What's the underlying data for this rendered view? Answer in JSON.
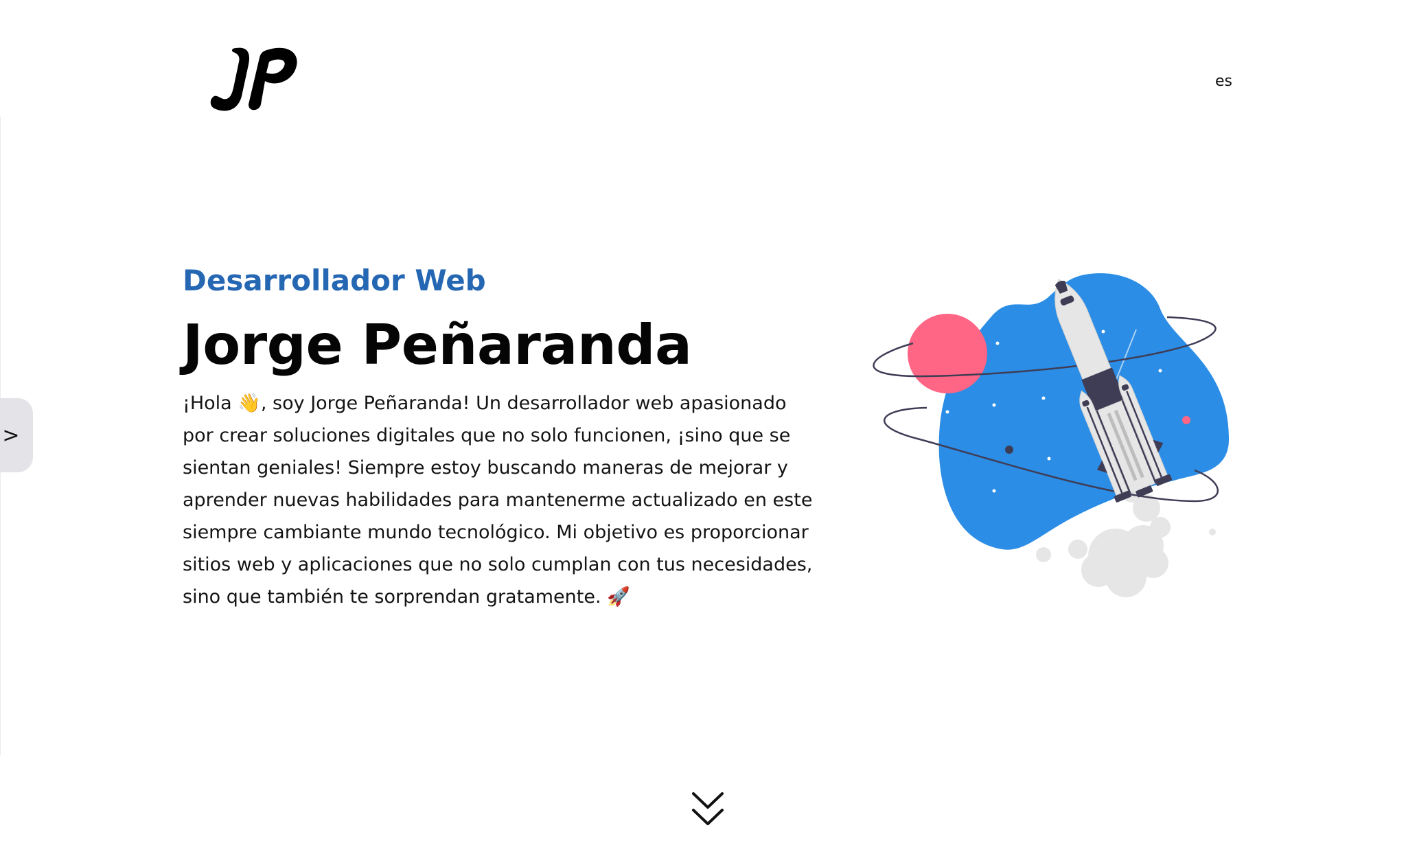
{
  "header": {
    "logo": "JP",
    "language": "es"
  },
  "sidebar": {
    "toggle_label": ">"
  },
  "hero": {
    "role": "Desarrollador Web",
    "name": "Jorge Peñaranda",
    "bio": "¡Hola 👋, soy Jorge Peñaranda! Un desarrollador web apasionado por crear soluciones digitales que no solo funcionen, ¡sino que se sientan geniales! Siempre estoy buscando maneras de mejorar y aprender nuevas habilidades para mantenerme actualizado en este siempre cambiante mundo tecnológico. Mi objetivo es proporcionar sitios web y aplicaciones que no solo cumplan con tus necesidades, sino que también te sorprendan gratamente. 🚀"
  },
  "icons": {
    "scroll": "double-chevron-down-icon",
    "illustration": "rocket-launch-illustration"
  },
  "colors": {
    "accent": "#2567b3",
    "blob": "#2b8de6",
    "planet": "#ff6584",
    "rocket_dark": "#3f3d56",
    "smoke": "#e6e6e6"
  }
}
